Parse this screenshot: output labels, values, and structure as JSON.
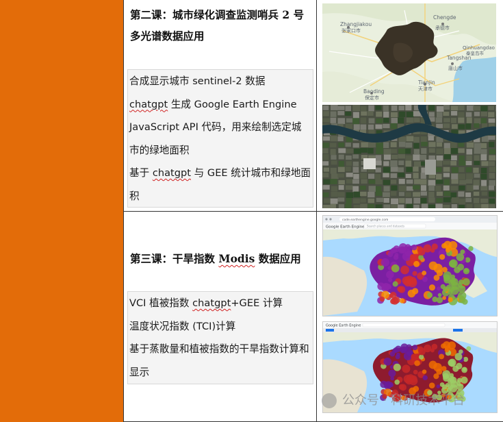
{
  "lesson2": {
    "title": "第二课：城市绿化调查监测哨兵 2 号多光谱数据应用",
    "bullets": [
      {
        "parts": [
          {
            "t": "合成显示城市 sentinel-2 数据"
          }
        ]
      },
      {
        "parts": [
          {
            "t": "chatgpt",
            "sq": true
          },
          {
            "t": " 生成  Google Earth Engine JavaScript API  代码，用来绘制选定城市的绿地面积"
          }
        ]
      },
      {
        "parts": [
          {
            "t": "基于 "
          },
          {
            "t": "chatgpt",
            "sq": true
          },
          {
            "t": " 与 GEE 统计城市和绿地面积"
          }
        ]
      }
    ],
    "map_labels": {
      "zhangjiakou_en": "Zhangjiakou",
      "zhangjiakou_cn": "张家口市",
      "chengde_en": "Chengde",
      "chengde_cn": "承德市",
      "qinhuangdao_en": "Qinhuangdao",
      "qinhuangdao_cn": "秦皇岛市",
      "tangshan_en": "Tangshan",
      "tangshan_cn": "唐山市",
      "tianjin_en": "Tianjin",
      "tianjin_cn": "天津市",
      "baoding_en": "Baoding",
      "baoding_cn": "保定市"
    }
  },
  "lesson3": {
    "title": "第三课：干旱指数 Modis 数据应用",
    "title_parts": [
      {
        "t": "第三课：干旱指数 "
      },
      {
        "t": "Modis",
        "sq": true
      },
      {
        "t": " 数据应用"
      }
    ],
    "bullets": [
      {
        "parts": [
          {
            "t": "VCI 植被指数 "
          },
          {
            "t": "chatgpt",
            "sq": true
          },
          {
            "t": "+GEE 计算"
          }
        ]
      },
      {
        "parts": [
          {
            "t": "温度状况指数  (TCI)计算"
          }
        ]
      },
      {
        "parts": [
          {
            "t": "基于蒸散量和植被指数的干旱指数计算和显示"
          }
        ]
      }
    ],
    "gee_app_name": "Google Earth Engine",
    "gee_url": "code.earthengine.google.com",
    "gee_search_placeholder": "Search places and datasets"
  },
  "watermark": "公众号 · 科研技术平台",
  "colors": {
    "orange": "#e36c09",
    "border": "#333333",
    "bullet_bg": "#f4f4f4",
    "squiggle": "#d02020"
  }
}
